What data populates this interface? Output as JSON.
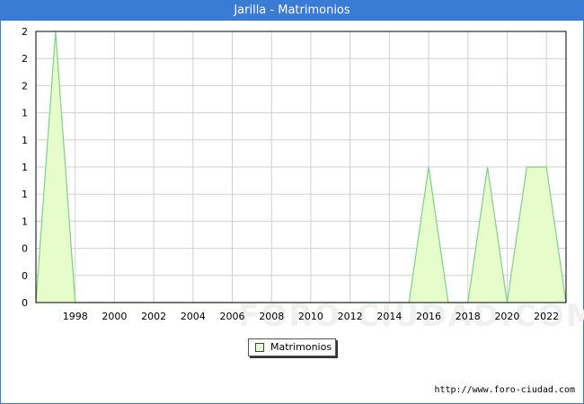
{
  "window": {
    "title": "Jarilla - Matrimonios"
  },
  "footer": {
    "url": "http://www.foro-ciudad.com"
  },
  "watermark": "FORO-CIUDAD.COM",
  "colors": {
    "title_bar": "#3a7bd5",
    "area_fill": "#e6fccb",
    "area_line": "#7fcf8a",
    "grid": "#d0d0d0"
  },
  "chart_data": {
    "type": "area",
    "title": "Jarilla - Matrimonios",
    "x": [
      1996,
      1997,
      1998,
      1999,
      2000,
      2001,
      2002,
      2003,
      2004,
      2005,
      2006,
      2007,
      2008,
      2009,
      2010,
      2011,
      2012,
      2013,
      2014,
      2015,
      2016,
      2017,
      2018,
      2019,
      2020,
      2021,
      2022,
      2023
    ],
    "series": [
      {
        "name": "Matrimonios",
        "values": [
          0,
          2,
          0,
          0,
          0,
          0,
          0,
          0,
          0,
          0,
          0,
          0,
          0,
          0,
          0,
          0,
          0,
          0,
          0,
          0,
          1,
          0,
          0,
          1,
          0,
          1,
          1,
          0
        ]
      }
    ],
    "x_tick_labels": [
      "1998",
      "2000",
      "2002",
      "2004",
      "2006",
      "2008",
      "2010",
      "2012",
      "2014",
      "2016",
      "2018",
      "2020",
      "2022"
    ],
    "y_tick_labels": [
      "2",
      "2",
      "2",
      "1",
      "1",
      "1",
      "1",
      "1",
      "0",
      "0",
      "0"
    ],
    "ylim": [
      0,
      2
    ],
    "xlim": [
      1996,
      2023
    ],
    "legend": {
      "position": "bottom-center",
      "entries": [
        "Matrimonios"
      ]
    },
    "grid": true
  }
}
